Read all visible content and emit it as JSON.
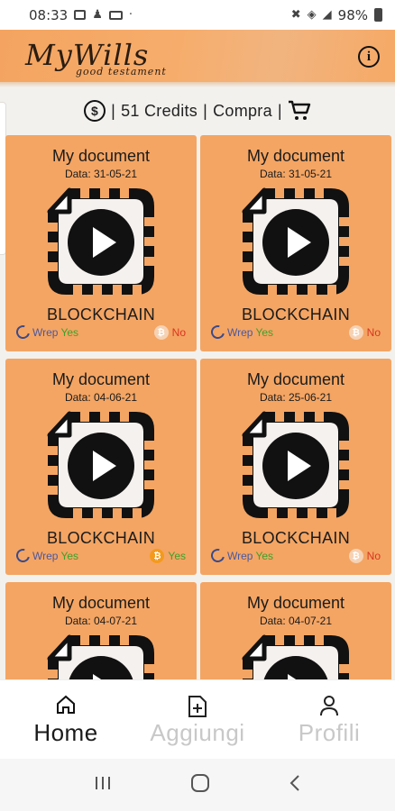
{
  "status_bar": {
    "time": "08:33",
    "left_icons": [
      "image-icon",
      "person-icon",
      "laptop-icon",
      "dot-icon"
    ],
    "right_icons": [
      "mute-icon",
      "wifi-icon",
      "signal-icon",
      "battery-icon"
    ],
    "battery": "98%"
  },
  "header": {
    "title": "MyWills",
    "subtitle": "good testament",
    "info_icon": "info-icon",
    "background_color": "#f4a460"
  },
  "credits_bar": {
    "dollar_icon": "dollar-circle-icon",
    "separator": "|",
    "credits": "51 Credits",
    "buy_label": "Compra",
    "cart_icon": "shopping-cart-icon"
  },
  "documents": [
    {
      "title": "My document",
      "date": "Data: 31-05-21",
      "chain": "BLOCKCHAIN",
      "wrep_label": "Wrep",
      "wrep_value": "Yes",
      "btc_value": "No",
      "btc_active": false
    },
    {
      "title": "My document",
      "date": "Data: 31-05-21",
      "chain": "BLOCKCHAIN",
      "wrep_label": "Wrep",
      "wrep_value": "Yes",
      "btc_value": "No",
      "btc_active": false
    },
    {
      "title": "My document",
      "date": "Data: 04-06-21",
      "chain": "BLOCKCHAIN",
      "wrep_label": "Wrep",
      "wrep_value": "Yes",
      "btc_value": "Yes",
      "btc_active": true
    },
    {
      "title": "My document",
      "date": "Data: 25-06-21",
      "chain": "BLOCKCHAIN",
      "wrep_label": "Wrep",
      "wrep_value": "Yes",
      "btc_value": "No",
      "btc_active": false
    },
    {
      "title": "My document",
      "date": "Data: 04-07-21",
      "chain": "",
      "wrep_label": "",
      "wrep_value": "",
      "btc_value": "",
      "btc_active": false
    },
    {
      "title": "My document",
      "date": "Data: 04-07-21",
      "chain": "",
      "wrep_label": "",
      "wrep_value": "",
      "btc_value": "",
      "btc_active": false
    }
  ],
  "bottom_nav": {
    "items": [
      {
        "label": "Home",
        "icon": "home-icon",
        "active": true
      },
      {
        "label": "Aggiungi",
        "icon": "add-document-icon",
        "active": false
      },
      {
        "label": "Profili",
        "icon": "person-icon",
        "active": false
      }
    ]
  },
  "system_nav": {
    "icons": [
      "recent-apps-icon",
      "home-circle-icon",
      "back-icon"
    ]
  },
  "colors": {
    "card": "#f4a563",
    "yes": "#3da12a",
    "no": "#d9351f",
    "bitcoin": "#f39a1d",
    "wrep": "#4a58a0"
  }
}
